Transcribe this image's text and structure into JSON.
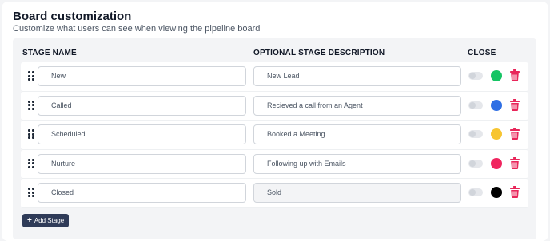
{
  "header": {
    "title": "Board customization",
    "subtitle": "Customize what users can see when viewing the pipeline board"
  },
  "columns": {
    "stage_name": "STAGE NAME",
    "description": "OPTIONAL STAGE DESCRIPTION",
    "close": "CLOSE"
  },
  "stages": [
    {
      "name": "New",
      "description": "New Lead",
      "close": false,
      "color": "#16c464",
      "description_readonly": false
    },
    {
      "name": "Called",
      "description": "Recieved a call from an Agent",
      "close": false,
      "color": "#2f6fe4",
      "description_readonly": false
    },
    {
      "name": "Scheduled",
      "description": "Booked a Meeting",
      "close": false,
      "color": "#f7c531",
      "description_readonly": false
    },
    {
      "name": "Nurture",
      "description": "Following up with Emails",
      "close": false,
      "color": "#f0255f",
      "description_readonly": false
    },
    {
      "name": "Closed",
      "description": "Sold",
      "close": false,
      "color": "#000000",
      "description_readonly": true
    }
  ],
  "icons": {
    "drag": "drag-handle-icon",
    "delete": "trash-icon",
    "add": "plus-icon"
  },
  "colors": {
    "delete_icon": "#e8265a",
    "button_bg": "#2f3b58"
  },
  "actions": {
    "add_stage": "Add Stage"
  }
}
